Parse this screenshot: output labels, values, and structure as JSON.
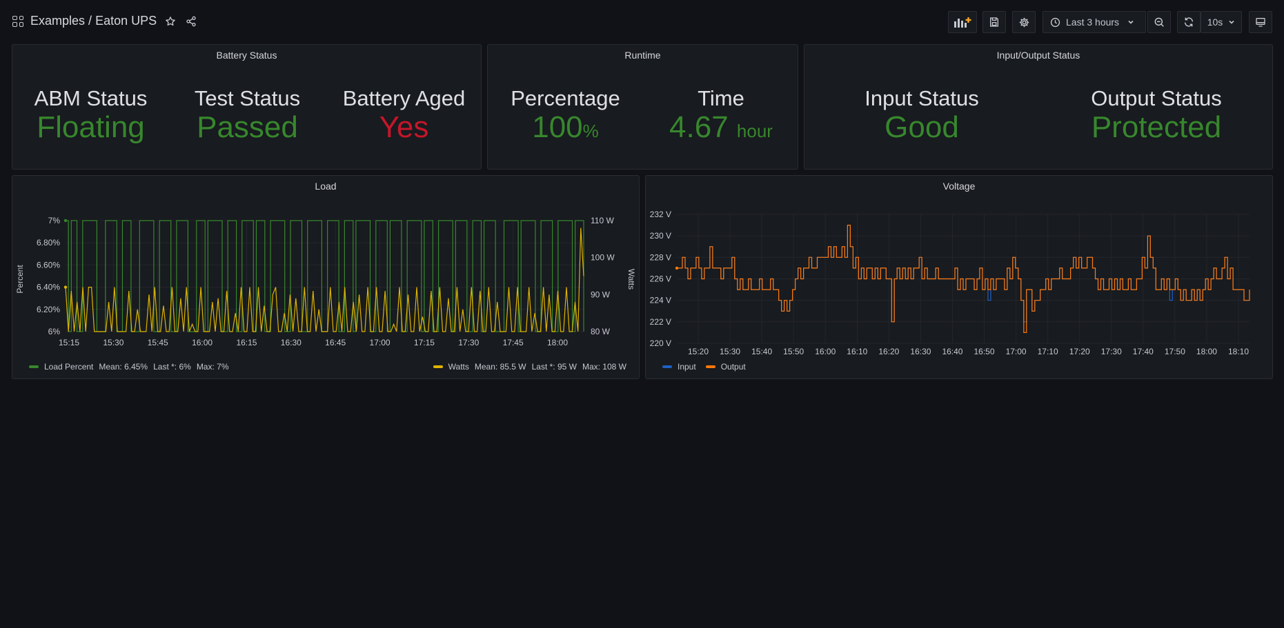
{
  "breadcrumb": {
    "folder": "Examples",
    "separator": "/",
    "dashboard": "Eaton UPS"
  },
  "toolbar": {
    "time_range": "Last 3 hours",
    "refresh_interval": "10s"
  },
  "panels": {
    "battery": {
      "title": "Battery Status",
      "stats": [
        {
          "label": "ABM Status",
          "value": "Floating",
          "color": "#37872d"
        },
        {
          "label": "Test Status",
          "value": "Passed",
          "color": "#37872d"
        },
        {
          "label": "Battery Aged",
          "value": "Yes",
          "color": "#c4162a"
        }
      ]
    },
    "runtime": {
      "title": "Runtime",
      "percentage": {
        "label": "Percentage",
        "value": "100",
        "unit": "%"
      },
      "time": {
        "label": "Time",
        "value": "4.67",
        "unit": "hour"
      }
    },
    "io": {
      "title": "Input/Output Status",
      "stats": [
        {
          "label": "Input Status",
          "value": "Good",
          "color": "#37872d"
        },
        {
          "label": "Output Status",
          "value": "Protected",
          "color": "#37872d"
        }
      ]
    },
    "load": {
      "title": "Load",
      "left_axis_label": "Percent",
      "right_axis_label": "Watts",
      "legend": [
        {
          "name": "Load Percent",
          "mean": "Mean: 6.45%",
          "last": "Last *: 6%",
          "max": "Max: 7%",
          "color": "#37872d"
        },
        {
          "name": "Watts",
          "mean": "Mean: 85.5 W",
          "last": "Last *: 95 W",
          "max": "Max: 108 W",
          "color": "#e0b400"
        }
      ]
    },
    "voltage": {
      "title": "Voltage",
      "legend": [
        {
          "name": "Input",
          "color": "#1f60c4"
        },
        {
          "name": "Output",
          "color": "#ff780a"
        }
      ]
    }
  },
  "chart_data": [
    {
      "type": "line",
      "title": "Load",
      "x_ticks": [
        "15:15",
        "15:30",
        "15:45",
        "16:00",
        "16:15",
        "16:30",
        "16:45",
        "17:00",
        "17:15",
        "17:30",
        "17:45",
        "18:00"
      ],
      "y_left_ticks": [
        "6%",
        "6.20%",
        "6.40%",
        "6.60%",
        "6.80%",
        "7%"
      ],
      "y_left_range": [
        6,
        7
      ],
      "y_right_ticks": [
        "80 W",
        "90 W",
        "100 W",
        "110 W"
      ],
      "y_right_range": [
        80,
        110
      ],
      "ylabel_left": "Percent",
      "ylabel_right": "Watts",
      "series": [
        {
          "name": "Load Percent",
          "axis": "left",
          "values": [
            7,
            6,
            7,
            7,
            6,
            6,
            7,
            7,
            7,
            7,
            7,
            6,
            6,
            6,
            7,
            7,
            7,
            7,
            6,
            6,
            7,
            7,
            7,
            6,
            6,
            6,
            7,
            7,
            7,
            7,
            7,
            6,
            6,
            7,
            7,
            7,
            7,
            6,
            6,
            7,
            7,
            7,
            7,
            6,
            6,
            6,
            7,
            7,
            7,
            6,
            7,
            7,
            7,
            7,
            7,
            6,
            6,
            7,
            7,
            7,
            6,
            6,
            7,
            7,
            7,
            7,
            6,
            7,
            7,
            7,
            6,
            6,
            7,
            7,
            7,
            7,
            7,
            6,
            6,
            7,
            7,
            7,
            7,
            6,
            6,
            7,
            7,
            7,
            7,
            7,
            6,
            6,
            7,
            7,
            7,
            7,
            6,
            6,
            7,
            7,
            7,
            6,
            7,
            7,
            7,
            7,
            7,
            6,
            6,
            7,
            7,
            7,
            7,
            6,
            7,
            7,
            7,
            7,
            6,
            6,
            7,
            7,
            7,
            7,
            7,
            6,
            7,
            7,
            7,
            6,
            6,
            7,
            7,
            7,
            7,
            7,
            6,
            7,
            7,
            7,
            7,
            6,
            6,
            7,
            7,
            7,
            6,
            7,
            7,
            7,
            7,
            6,
            6,
            6,
            7,
            7,
            7,
            7,
            7,
            6,
            7,
            7,
            7,
            7,
            7,
            6,
            6,
            7,
            7,
            7,
            7,
            6,
            6,
            7,
            7,
            7,
            7,
            7,
            6,
            7,
            7,
            7,
            6
          ]
        },
        {
          "name": "Watts",
          "axis": "right",
          "values": [
            92,
            80,
            91,
            80,
            88,
            80,
            92,
            80,
            92,
            92,
            80,
            80,
            80,
            80,
            80,
            88,
            80,
            92,
            80,
            80,
            80,
            80,
            91,
            80,
            80,
            86,
            80,
            80,
            80,
            90,
            80,
            92,
            80,
            80,
            87,
            80,
            80,
            92,
            80,
            80,
            89,
            80,
            92,
            80,
            82,
            80,
            80,
            92,
            80,
            80,
            80,
            88,
            80,
            89,
            80,
            80,
            91,
            80,
            80,
            85,
            80,
            92,
            80,
            80,
            92,
            80,
            80,
            92,
            80,
            87,
            80,
            80,
            90,
            92,
            80,
            80,
            85,
            80,
            90,
            80,
            89,
            80,
            80,
            92,
            80,
            80,
            91,
            80,
            86,
            80,
            80,
            80,
            92,
            80,
            80,
            88,
            80,
            92,
            80,
            80,
            88,
            80,
            90,
            80,
            80,
            92,
            80,
            80,
            92,
            80,
            80,
            91,
            80,
            80,
            82,
            80,
            92,
            80,
            80,
            90,
            80,
            80,
            92,
            80,
            84,
            80,
            80,
            91,
            80,
            80,
            92,
            80,
            80,
            89,
            80,
            80,
            92,
            80,
            86,
            80,
            80,
            92,
            80,
            80,
            91,
            80,
            80,
            92,
            80,
            80,
            88,
            80,
            80,
            80,
            92,
            80,
            80,
            92,
            80,
            80,
            80,
            92,
            80,
            85,
            80,
            80,
            92,
            80,
            90,
            80,
            80,
            91,
            80,
            80,
            92,
            80,
            80,
            88,
            80,
            108,
            95
          ]
        }
      ]
    },
    {
      "type": "line",
      "title": "Voltage",
      "x_ticks": [
        "15:20",
        "15:30",
        "15:40",
        "15:50",
        "16:00",
        "16:10",
        "16:20",
        "16:30",
        "16:40",
        "16:50",
        "17:00",
        "17:10",
        "17:20",
        "17:30",
        "17:40",
        "17:50",
        "18:00",
        "18:10"
      ],
      "y_ticks": [
        "220 V",
        "222 V",
        "224 V",
        "226 V",
        "228 V",
        "230 V",
        "232 V"
      ],
      "y_range": [
        220,
        232
      ],
      "series": [
        {
          "name": "Input",
          "values": [
            227,
            227,
            228,
            227,
            226,
            227,
            227,
            228,
            227,
            226,
            227,
            227,
            229,
            227,
            227,
            227,
            226,
            227,
            227,
            227,
            228,
            226,
            225,
            226,
            225,
            225,
            226,
            225,
            225,
            225,
            226,
            225,
            225,
            225,
            226,
            225,
            225,
            224,
            223,
            224,
            223,
            224,
            225,
            226,
            227,
            226,
            227,
            227,
            228,
            227,
            227,
            228,
            228,
            228,
            228,
            229,
            228,
            229,
            228,
            228,
            229,
            228,
            231,
            229,
            227,
            228,
            226,
            227,
            226,
            227,
            227,
            226,
            227,
            226,
            227,
            227,
            226,
            226,
            222,
            226,
            227,
            226,
            227,
            226,
            227,
            226,
            227,
            227,
            228,
            226,
            227,
            226,
            226,
            226,
            227,
            226,
            226,
            226,
            226,
            226,
            226,
            227,
            225,
            226,
            225,
            226,
            226,
            226,
            225,
            226,
            227,
            225,
            226,
            224,
            226,
            225,
            226,
            226,
            226,
            225,
            227,
            226,
            228,
            227,
            226,
            224,
            222,
            225,
            225,
            223,
            224,
            224,
            225,
            225,
            226,
            225,
            226,
            226,
            226,
            227,
            226,
            226,
            226,
            227,
            228,
            227,
            228,
            227,
            227,
            228,
            228,
            227,
            226,
            225,
            226,
            225,
            225,
            226,
            225,
            226,
            225,
            226,
            225,
            225,
            226,
            225,
            225,
            226,
            226,
            228,
            227,
            230,
            228,
            227,
            225,
            225,
            226,
            225,
            226,
            224,
            225,
            226,
            225,
            224,
            225,
            224,
            224,
            225,
            224,
            225,
            224,
            225,
            226,
            225,
            226,
            227,
            226,
            226,
            227,
            228,
            226,
            227,
            225,
            225,
            225,
            225,
            224,
            224,
            225
          ]
        },
        {
          "name": "Output",
          "values": [
            227,
            227,
            228,
            227,
            226,
            227,
            227,
            228,
            227,
            226,
            227,
            227,
            229,
            227,
            227,
            227,
            226,
            227,
            227,
            227,
            228,
            226,
            225,
            226,
            225,
            225,
            226,
            225,
            225,
            225,
            226,
            225,
            225,
            225,
            226,
            225,
            225,
            224,
            223,
            224,
            223,
            224,
            225,
            226,
            227,
            226,
            227,
            227,
            228,
            227,
            227,
            228,
            228,
            228,
            228,
            229,
            228,
            229,
            228,
            228,
            229,
            228,
            231,
            229,
            227,
            228,
            226,
            227,
            226,
            227,
            227,
            226,
            227,
            226,
            227,
            227,
            226,
            226,
            222,
            226,
            227,
            226,
            227,
            226,
            227,
            226,
            227,
            227,
            228,
            226,
            227,
            226,
            226,
            226,
            227,
            226,
            226,
            226,
            226,
            226,
            226,
            227,
            225,
            226,
            225,
            226,
            226,
            226,
            225,
            226,
            227,
            225,
            226,
            225,
            226,
            225,
            226,
            226,
            226,
            225,
            227,
            226,
            228,
            227,
            226,
            224,
            221,
            225,
            225,
            223,
            224,
            224,
            225,
            225,
            226,
            225,
            226,
            226,
            226,
            227,
            226,
            226,
            226,
            227,
            228,
            227,
            228,
            227,
            227,
            228,
            228,
            227,
            226,
            225,
            226,
            225,
            225,
            226,
            225,
            226,
            225,
            226,
            225,
            225,
            226,
            225,
            225,
            226,
            226,
            228,
            227,
            230,
            228,
            227,
            225,
            225,
            226,
            225,
            226,
            225,
            225,
            226,
            225,
            224,
            225,
            224,
            224,
            225,
            224,
            225,
            224,
            225,
            226,
            225,
            226,
            227,
            226,
            226,
            227,
            228,
            226,
            227,
            225,
            225,
            225,
            225,
            224,
            224,
            225
          ]
        }
      ]
    }
  ]
}
